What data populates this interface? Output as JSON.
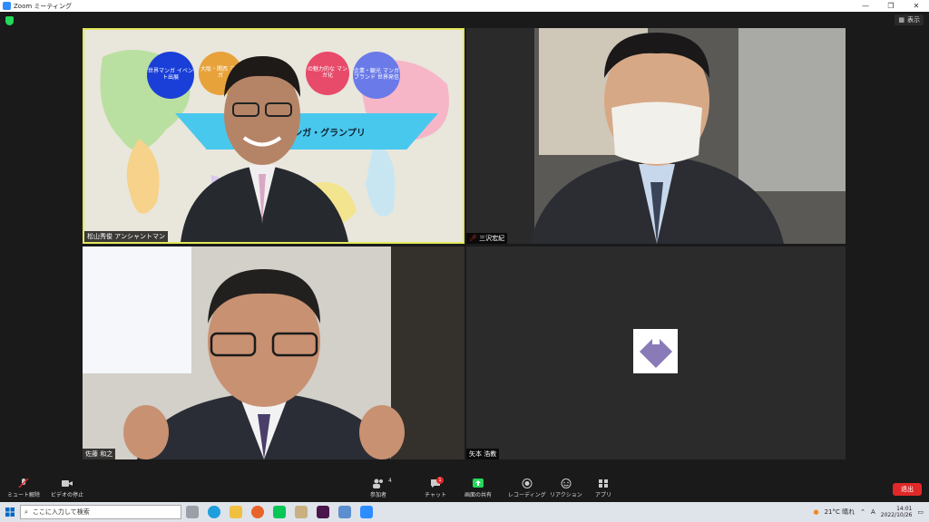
{
  "window": {
    "title": "Zoom ミーティング",
    "min": "—",
    "max": "❐",
    "close": "✕"
  },
  "view_button": {
    "label": "表示"
  },
  "participants": [
    {
      "name": "松山秀俊 アンシャントマン"
    },
    {
      "name": "三沢宏紀"
    },
    {
      "name": "佐藤 和之"
    },
    {
      "name": "矢本 浩教"
    }
  ],
  "slide": {
    "bubble1": "世界マンガ イベント出展",
    "bubble2": "大阪・関西 マンガ",
    "bubble3": "の魅力的な マンガ化",
    "bubble4": "企業・観光 マンガブランド 世界発信",
    "banner": "大阪国際マンガ・グランプリ"
  },
  "toolbar": {
    "mute": "ミュート解除",
    "video": "ビデオの停止",
    "participants": "参加者",
    "participants_count": "4",
    "chat": "チャット",
    "chat_badge": "1",
    "share": "画面の共有",
    "record": "レコーディング",
    "reactions": "リアクション",
    "apps": "アプリ",
    "leave": "退出"
  },
  "taskbar": {
    "search_placeholder": "ここに入力して検索",
    "weather": "21°C 晴れ",
    "ime": "A",
    "time": "14:01",
    "date": "2022/10/26"
  },
  "colors": {
    "active_speaker": "#e3e85a",
    "leave": "#e02828",
    "share": "#23d959",
    "zoom": "#2d8cff"
  }
}
